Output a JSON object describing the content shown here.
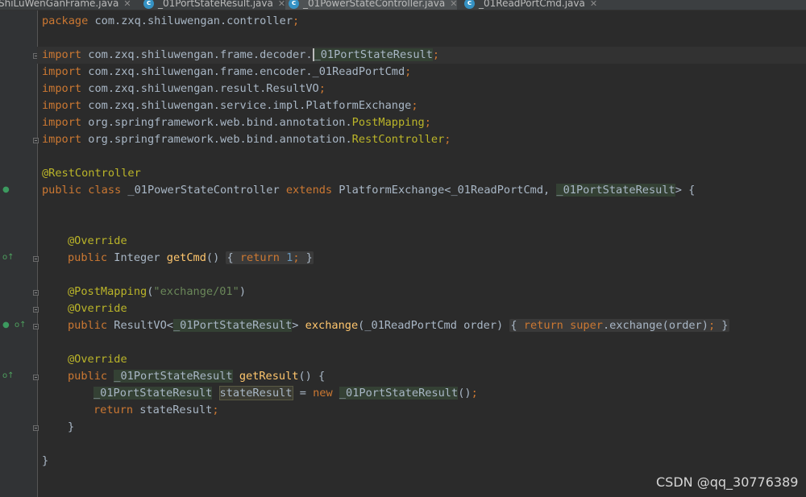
{
  "tabs": [
    {
      "label": "ShiLuWenGanFrame.java"
    },
    {
      "label": "_01PortStateResult.java"
    },
    {
      "label": "_01PowerStateController.java"
    },
    {
      "label": "_01ReadPortCmd.java"
    }
  ],
  "code": {
    "package_kw": "package",
    "package_name": " com.zxq.shiluwengan.controller",
    "import_kw": "import",
    "imports": [
      {
        "path": " com.zxq.shiluwengan.frame.decoder.",
        "name": "_01PortStateResult"
      },
      {
        "path": " com.zxq.shiluwengan.frame.encoder._01ReadPortCmd"
      },
      {
        "path": " com.zxq.shiluwengan.result.ResultVO"
      },
      {
        "path": " com.zxq.shiluwengan.service.impl.PlatformExchange"
      },
      {
        "path": " org.springframework.web.bind.annotation.",
        "name": "PostMapping"
      },
      {
        "path": " org.springframework.web.bind.annotation.",
        "name": "RestController"
      }
    ],
    "rest_controller": "@RestController",
    "class_decl": {
      "modifiers": "public class",
      "name": " _01PowerStateController ",
      "extends_kw": "extends",
      "parent": " PlatformExchange<_01ReadPortCmd, ",
      "parent_arg2": "_01PortStateResult",
      "close": "> {"
    },
    "override": "@Override",
    "getcmd": {
      "mods": "public",
      "type": " Integer ",
      "name": "getCmd",
      "return_kw": "return",
      "value": "1"
    },
    "post_mapping": {
      "ann": "@PostMapping",
      "arg": "\"exchange/01\""
    },
    "exchange": {
      "mods": "public",
      "type_pre": " ResultVO<",
      "type_arg": "_01PortStateResult",
      "type_post": "> ",
      "name": "exchange",
      "params": "(_01ReadPortCmd order)",
      "return_kw": "return",
      "super_kw": "super",
      "call": ".exchange(order)"
    },
    "getresult": {
      "mods": "public",
      "type": "_01PortStateResult",
      "name": "getResult",
      "params": "() {"
    },
    "body": {
      "type": "_01PortStateResult",
      "var": "stateResult",
      "assign": " = ",
      "new_kw": "new",
      "ctor": "_01PortStateResult",
      "ctor_end": "()",
      "return_kw": "return",
      "return_val": " stateResult"
    },
    "close_brace": "}"
  },
  "watermark": "CSDN @qq_30776389"
}
